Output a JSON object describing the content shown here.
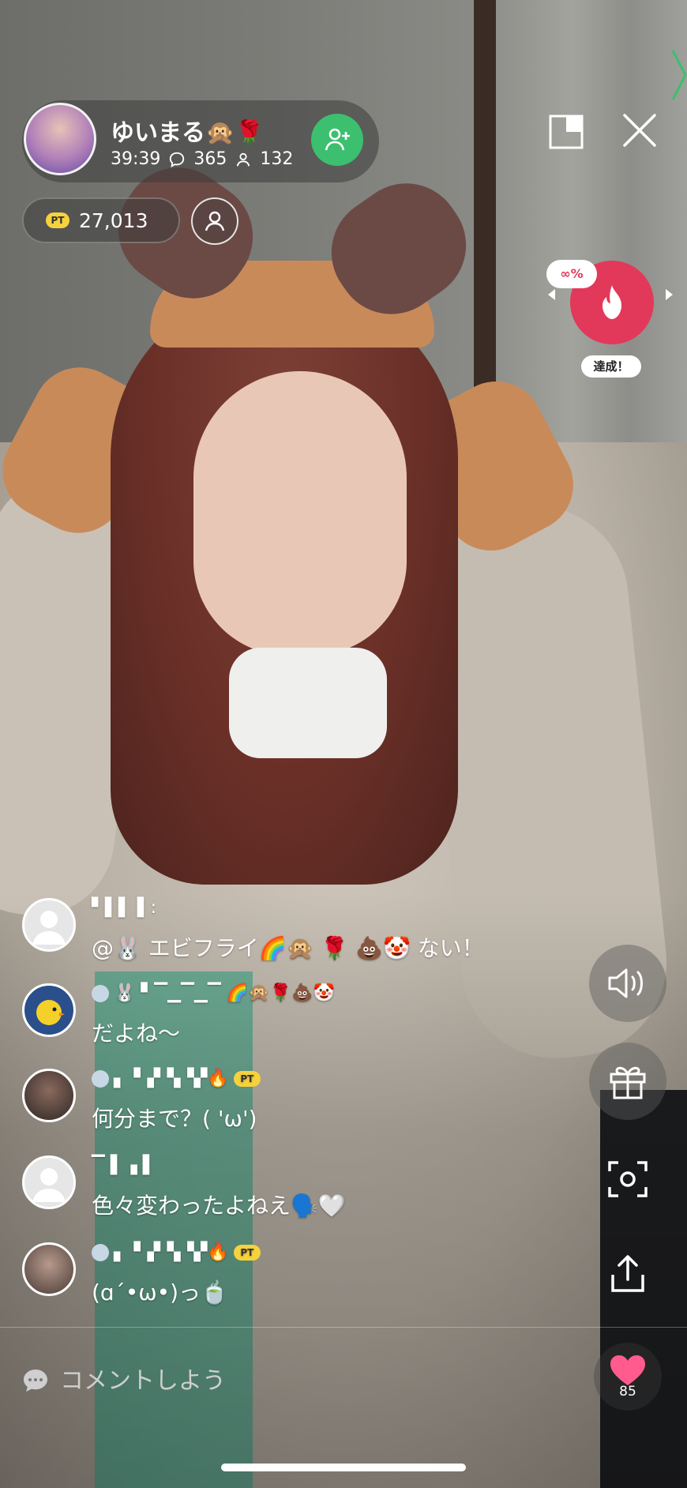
{
  "header": {
    "host_name": "ゆいまる🙊🌹",
    "elapsed": "39:39",
    "comments": "365",
    "viewers": "132",
    "points": "27,013",
    "pt_badge": "PT"
  },
  "mission": {
    "percent": "∞%",
    "label": "達成！",
    "accent": "#e2395a"
  },
  "comments": [
    {
      "name": "▘▌▌ ▌:",
      "text": "@🐰 エビフライ🌈🙊 🌹 💩🤡 ない！",
      "avatar": "default"
    },
    {
      "name": "🐰 ▘▔▁▔▁▔ 🌈🙊🌹💩🤡",
      "text": "だよね〜",
      "avatar": "chick"
    },
    {
      "name": "▖▝▗▘▚▝▞🔥",
      "text": "何分まで？( 'ω')",
      "avatar": "photo",
      "badge": "PT"
    },
    {
      "name": "▔ ▌▗ ▌",
      "text": "色々変わったよねえ🗣️🤍",
      "avatar": "default"
    },
    {
      "name": "▖▝▗▘▚▝▞🔥",
      "text": "(ɑ΄•ω•)っ🍵",
      "avatar": "photo",
      "badge": "PT"
    }
  ],
  "rail": {
    "like_count": "85"
  },
  "input": {
    "placeholder": "コメントしよう"
  },
  "colors": {
    "follow": "#3cbf6e",
    "like": "#ff5b8e",
    "pt_badge": "#f6d23c"
  }
}
